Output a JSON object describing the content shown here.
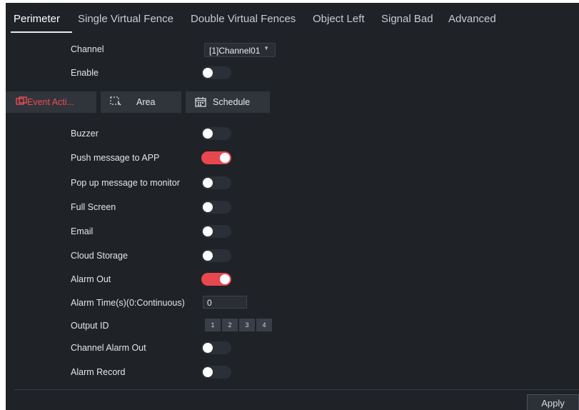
{
  "tabs": [
    "Perimeter",
    "Single Virtual Fence",
    "Double Virtual Fences",
    "Object Left",
    "Signal Bad",
    "Advanced"
  ],
  "active_tab": "Perimeter",
  "channel": {
    "label": "Channel",
    "value": "[1]Channel01"
  },
  "enable": {
    "label": "Enable",
    "on": false
  },
  "subtabs": {
    "event": "Event Acti...",
    "area": "Area",
    "schedule": "Schedule"
  },
  "actions": {
    "buzzer": {
      "label": "Buzzer",
      "on": false
    },
    "push_app": {
      "label": "Push message to APP",
      "on": true
    },
    "popup": {
      "label": "Pop up message to monitor",
      "on": false
    },
    "full_screen": {
      "label": "Full Screen",
      "on": false
    },
    "email": {
      "label": "Email",
      "on": false
    },
    "cloud": {
      "label": "Cloud Storage",
      "on": false
    },
    "alarm_out": {
      "label": "Alarm Out",
      "on": true
    },
    "alarm_time": {
      "label": "Alarm Time(s)(0:Continuous)",
      "value": "0"
    },
    "output_id": {
      "label": "Output ID",
      "ids": [
        "1",
        "2",
        "3",
        "4"
      ]
    },
    "channel_alarm_out": {
      "label": "Channel Alarm Out",
      "on": false
    },
    "alarm_record": {
      "label": "Alarm Record",
      "on": false
    }
  },
  "apply_label": "Apply",
  "colors": {
    "accent": "#e8474f",
    "background": "#1f2227"
  }
}
